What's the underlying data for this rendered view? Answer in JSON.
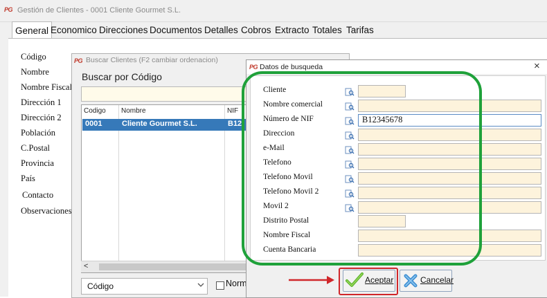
{
  "main": {
    "title": "Gestión de Clientes - 0001 Cliente Gourmet S.L.",
    "logo_text": "PG",
    "tabs": [
      "General",
      "Economico",
      "Direcciones",
      "Documentos",
      "Detalles",
      "Cobros",
      "Extracto",
      "Totales",
      "Tarifas"
    ],
    "field_labels": [
      "Código",
      "Nombre",
      "Nombre Fiscal",
      "Dirección 1",
      "Dirección 2",
      "Población",
      "C.Postal",
      "Provincia",
      "País",
      "Contacto",
      "Observaciones"
    ]
  },
  "buscar": {
    "title": "Buscar Clientes  (F2 cambiar ordenacion)",
    "header": "Buscar por Código",
    "columns": [
      "Codigo",
      "Nombre",
      "NIF"
    ],
    "rows": [
      {
        "codigo": "0001",
        "nombre": "Cliente Gourmet S.L.",
        "nif": "B12"
      }
    ],
    "scroll_left": "<",
    "order_select": "Código",
    "checkbox_label": "Norma"
  },
  "datos": {
    "title": "Datos de busqueda",
    "close": "×",
    "fields": [
      {
        "label": "Cliente",
        "has_icon": true,
        "value": ""
      },
      {
        "label": "Nombre comercial",
        "has_icon": true,
        "value": ""
      },
      {
        "label": "Número de NIF",
        "has_icon": true,
        "value": "B12345678"
      },
      {
        "label": "Direccion",
        "has_icon": true,
        "value": ""
      },
      {
        "label": "e-Mail",
        "has_icon": true,
        "value": ""
      },
      {
        "label": "Telefono",
        "has_icon": true,
        "value": ""
      },
      {
        "label": "Telefono Movil",
        "has_icon": true,
        "value": ""
      },
      {
        "label": "Telefono Movil 2",
        "has_icon": true,
        "value": ""
      },
      {
        "label": "Movil 2",
        "has_icon": true,
        "value": ""
      },
      {
        "label": "Distrito Postal",
        "has_icon": false,
        "value": ""
      },
      {
        "label": "Nombre Fiscal",
        "has_icon": false,
        "value": ""
      },
      {
        "label": "Cuenta Bancaria",
        "has_icon": false,
        "value": ""
      }
    ],
    "accept_label": "Aceptar",
    "cancel_label": "Cancelar"
  },
  "colors": {
    "highlight_green": "#1fa13a",
    "highlight_red": "#d0262a",
    "selection_blue": "#3679b9",
    "input_fill": "#fdf3dc"
  }
}
